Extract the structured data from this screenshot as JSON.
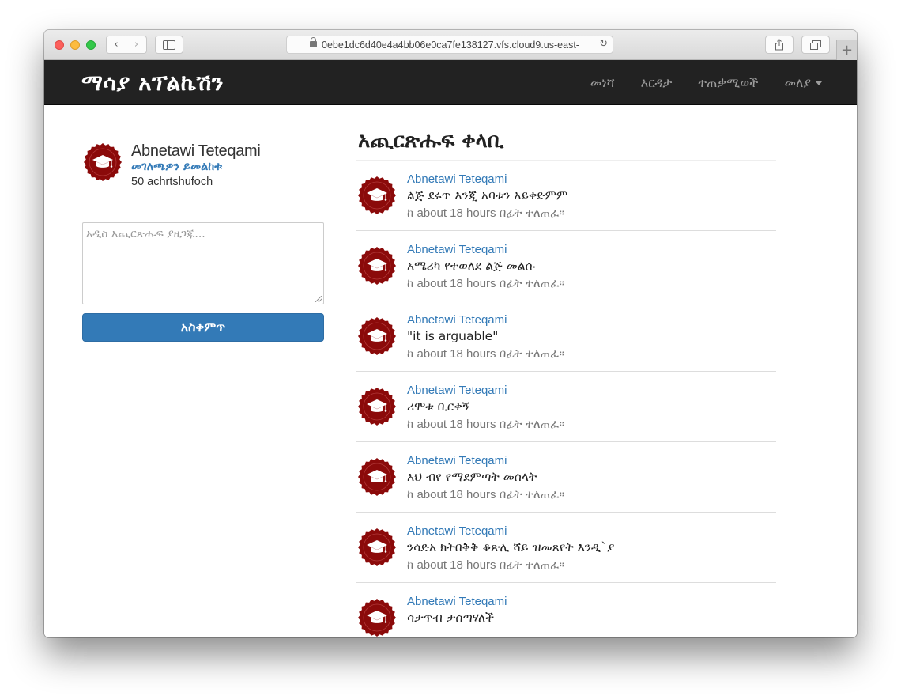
{
  "browser": {
    "url": "0ebe1dc6d40e4a4bb06e0ca7fe138127.vfs.cloud9.us-east-",
    "back_icon": "‹",
    "forward_icon": "›",
    "reload_icon": "↻",
    "new_tab_icon": "+"
  },
  "navbar": {
    "brand": "ማሳያ አፕልኬሽን",
    "links": [
      "መነሻ",
      "እርዳታ",
      "ተጠቃሚወች",
      "መለያ"
    ]
  },
  "profile": {
    "name": "Abnetawi Teteqami",
    "edit_link": "መገለጫዎን ይመልከቱ",
    "count": "50 achrtshufoch"
  },
  "compose": {
    "placeholder": "አዲስ አጪርጽሑፍ ያዘጋጁ...",
    "button_label": "አስቀምጥ"
  },
  "feed": {
    "title": "አጪርጽሑፍ ቀላቢ",
    "items": [
      {
        "user": "Abnetawi Teteqami",
        "text": "ልጅ ደሩጥ እንጂ አባቱን አይቀድምም",
        "time": "ከ about 18 hours በፊት ተለጠፈ።"
      },
      {
        "user": "Abnetawi Teteqami",
        "text": "አሜሪካ የተወለደ ልጅ መልሱ",
        "time": "ከ about 18 hours በፊት ተለጠፈ።"
      },
      {
        "user": "Abnetawi Teteqami",
        "text": "\"it is arguable\"",
        "time": "ከ about 18 hours በፊት ተለጠፈ።"
      },
      {
        "user": "Abnetawi Teteqami",
        "text": "ሪሞቱ ቢርቀኝ",
        "time": "ከ about 18 hours በፊት ተለጠፈ።"
      },
      {
        "user": "Abnetawi Teteqami",
        "text": "እህ ብየ የማደምጣት መሰላት",
        "time": "ከ about 18 hours በፊት ተለጠፈ።"
      },
      {
        "user": "Abnetawi Teteqami",
        "text": "ንሳድአ ክትበቅቅ ቆጽሊ ሻይ ዝመጸየት እንዲ`ያ",
        "time": "ከ about 18 hours በፊት ተለጠፈ።"
      },
      {
        "user": "Abnetawi Teteqami",
        "text": "ሳታጥብ ታሰጣሃለች",
        "time": ""
      }
    ]
  },
  "colors": {
    "navbar_bg": "#222222",
    "link_blue": "#337ab7",
    "avatar_maroon": "#8b0a0a"
  }
}
